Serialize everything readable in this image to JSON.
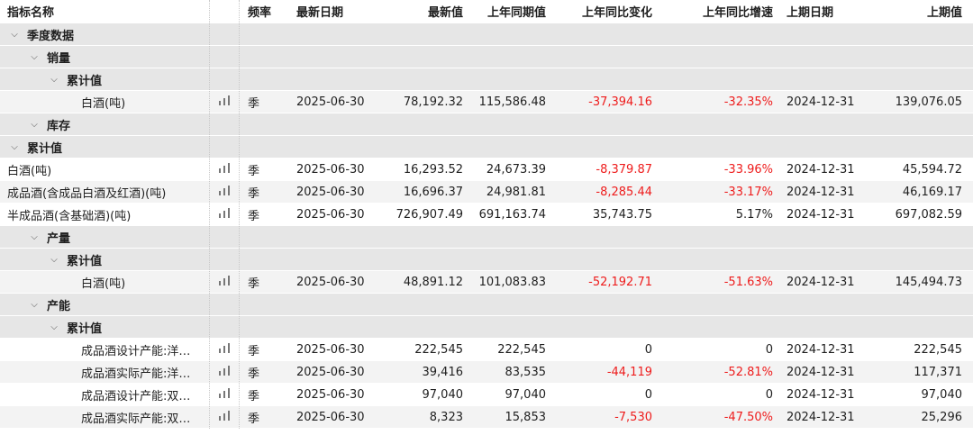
{
  "columns": {
    "name": "指标名称",
    "freq": "频率",
    "date": "最新日期",
    "latest": "最新值",
    "prev_year": "上年同期值",
    "yoy_change": "上年同比变化",
    "yoy_pct": "上年同比增速",
    "prev_date": "上期日期",
    "prev_value": "上期值"
  },
  "icons": {
    "chart": "bar-chart-icon",
    "expand": "chevron-down-icon"
  },
  "colors": {
    "negative": "#ee1c1c",
    "group_bg": "#e6e6e6",
    "row_bg": "#f3f3f3"
  },
  "rows": [
    {
      "kind": "group",
      "level": 0,
      "label": "季度数据"
    },
    {
      "kind": "group",
      "level": 1,
      "label": "销量"
    },
    {
      "kind": "group",
      "level": 2,
      "label": "累计值"
    },
    {
      "kind": "data",
      "level": 3,
      "name": "白酒(吨)",
      "freq": "季",
      "date": "2025-06-30",
      "latest": "78,192.32",
      "prev": "115,586.48",
      "chg": "-37,394.16",
      "pct": "-32.35%",
      "pdate": "2024-12-31",
      "pval": "139,076.05",
      "neg": true,
      "alt": false
    },
    {
      "kind": "group",
      "level": 1,
      "label": "库存"
    },
    {
      "kind": "group",
      "level": 0,
      "label": "累计值"
    },
    {
      "kind": "data",
      "level": 0,
      "name": "白酒(吨)",
      "freq": "季",
      "date": "2025-06-30",
      "latest": "16,293.52",
      "prev": "24,673.39",
      "chg": "-8,379.87",
      "pct": "-33.96%",
      "pdate": "2024-12-31",
      "pval": "45,594.72",
      "neg": true,
      "alt": true
    },
    {
      "kind": "data",
      "level": 0,
      "name": "成品酒(含成品白酒及红酒)(吨)",
      "freq": "季",
      "date": "2025-06-30",
      "latest": "16,696.37",
      "prev": "24,981.81",
      "chg": "-8,285.44",
      "pct": "-33.17%",
      "pdate": "2024-12-31",
      "pval": "46,169.17",
      "neg": true,
      "alt": false
    },
    {
      "kind": "data",
      "level": 0,
      "name": "半成品酒(含基础酒)(吨)",
      "freq": "季",
      "date": "2025-06-30",
      "latest": "726,907.49",
      "prev": "691,163.74",
      "chg": "35,743.75",
      "pct": "5.17%",
      "pdate": "2024-12-31",
      "pval": "697,082.59",
      "neg": false,
      "alt": true
    },
    {
      "kind": "group",
      "level": 1,
      "label": "产量"
    },
    {
      "kind": "group",
      "level": 2,
      "label": "累计值"
    },
    {
      "kind": "data",
      "level": 3,
      "name": "白酒(吨)",
      "freq": "季",
      "date": "2025-06-30",
      "latest": "48,891.12",
      "prev": "101,083.83",
      "chg": "-52,192.71",
      "pct": "-51.63%",
      "pdate": "2024-12-31",
      "pval": "145,494.73",
      "neg": true,
      "alt": false
    },
    {
      "kind": "group",
      "level": 1,
      "label": "产能"
    },
    {
      "kind": "group",
      "level": 2,
      "label": "累计值"
    },
    {
      "kind": "data",
      "level": 3,
      "name": "成品酒设计产能:洋…",
      "freq": "季",
      "date": "2025-06-30",
      "latest": "222,545",
      "prev": "222,545",
      "chg": "0",
      "pct": "0",
      "pdate": "2024-12-31",
      "pval": "222,545",
      "neg": false,
      "alt": true
    },
    {
      "kind": "data",
      "level": 3,
      "name": "成品酒实际产能:洋…",
      "freq": "季",
      "date": "2025-06-30",
      "latest": "39,416",
      "prev": "83,535",
      "chg": "-44,119",
      "pct": "-52.81%",
      "pdate": "2024-12-31",
      "pval": "117,371",
      "neg": true,
      "alt": false
    },
    {
      "kind": "data",
      "level": 3,
      "name": "成品酒设计产能:双…",
      "freq": "季",
      "date": "2025-06-30",
      "latest": "97,040",
      "prev": "97,040",
      "chg": "0",
      "pct": "0",
      "pdate": "2024-12-31",
      "pval": "97,040",
      "neg": false,
      "alt": true
    },
    {
      "kind": "data",
      "level": 3,
      "name": "成品酒实际产能:双…",
      "freq": "季",
      "date": "2025-06-30",
      "latest": "8,323",
      "prev": "15,853",
      "chg": "-7,530",
      "pct": "-47.50%",
      "pdate": "2024-12-31",
      "pval": "25,296",
      "neg": true,
      "alt": false
    }
  ]
}
